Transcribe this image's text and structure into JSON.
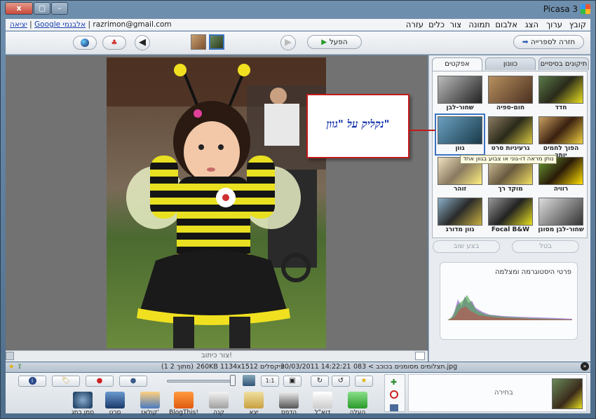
{
  "window": {
    "app_title": "Picasa 3",
    "close_glyph": "x",
    "max_glyph": "▢",
    "min_glyph": "–"
  },
  "menu": {
    "items": [
      "קובץ",
      "ערוך",
      "הצג",
      "אלבום",
      "תמונה",
      "צור",
      "כלים",
      "עזרה"
    ],
    "email": "razrimon@gmail.com",
    "google_link": "Google אלבנמי",
    "exit_link": "יציאה"
  },
  "toolbar": {
    "back_to_library": "חזרה לספרייה",
    "play": "הפעל",
    "globe_icon": "globe-icon",
    "friends_icon": "friends-icon"
  },
  "tabs": {
    "basic": "תיקונים בסיסיים",
    "tuning": "כוונון",
    "effects": "אפקטים"
  },
  "effects": [
    {
      "label": "חדד",
      "style": "sharpen"
    },
    {
      "label": "חום-ספיה",
      "style": "sepia"
    },
    {
      "label": "שחור-לבן",
      "style": "bw"
    },
    {
      "label": "הפוך לחמים יותר",
      "style": "warm"
    },
    {
      "label": "גרעיניות סרט",
      "style": "grain"
    },
    {
      "label": "גוון",
      "style": "tint"
    },
    {
      "label": "רוויה",
      "style": "saturate"
    },
    {
      "label": "מוקד רך",
      "style": "soft"
    },
    {
      "label": "זוהר",
      "style": "glow"
    },
    {
      "label": "שחור-לבן מסונן",
      "style": "bwfilter"
    },
    {
      "label": "Focal B&W",
      "style": "focalbw"
    },
    {
      "label": "גוון מדורג",
      "style": "gradtint"
    }
  ],
  "effect_actions": {
    "undo": "בטל",
    "redo": "בצע שוב"
  },
  "histogram": {
    "title": "פרטי היסטוגרמה ומצלמה"
  },
  "tooltip": "נותן מראה דו-גוני או צבוע בגוון אחד",
  "callout": "נקליק על \"גוון\"",
  "caption_placeholder": "צור כיתוב!",
  "status": {
    "path": "תצלומים מסומנים בכוכב > 083.jpg",
    "datetime": "20/03/2011 14:22:21",
    "dims": "1134x1512 פיקסלים",
    "size": "260KB",
    "count": "(1 מתוך 2)"
  },
  "tray": {
    "selection_label": "בחירה",
    "tools": [
      {
        "label": "העלה",
        "icon": "upload-icon"
      },
      {
        "label": "דוא\"ל",
        "icon": "email-icon"
      },
      {
        "label": "הדפס",
        "icon": "print-icon"
      },
      {
        "label": "יצא",
        "icon": "export-icon"
      },
      {
        "label": "קנה",
        "icon": "shop-icon"
      },
      {
        "label": "BlogThis!",
        "icon": "blogger-icon"
      },
      {
        "label": "קולאז'",
        "icon": "collage-icon"
      },
      {
        "label": "סרט",
        "icon": "movie-icon"
      },
      {
        "label": "סמן בתג",
        "icon": "geotag-icon"
      }
    ]
  },
  "colors": {
    "accent": "#3c74c4",
    "callout_border": "#c21a1a",
    "callout_text": "#0a2aa8"
  }
}
